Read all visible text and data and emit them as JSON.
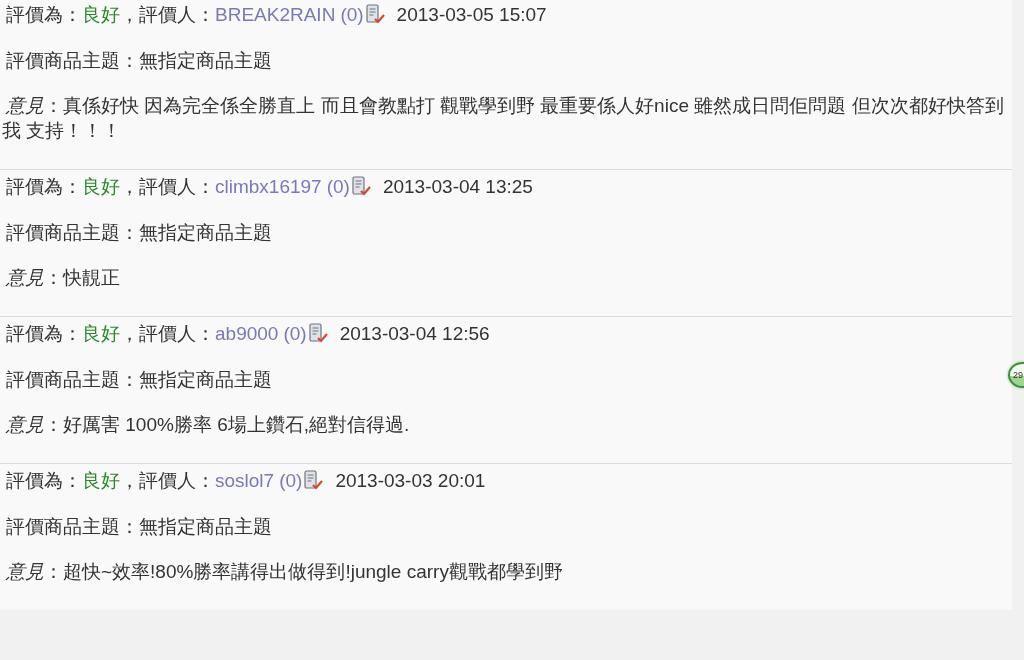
{
  "reviews": [
    {
      "rating_label": "評價為：",
      "rating": "良好",
      "reviewer_label": "，評價人：",
      "reviewer": "BREAK2RAIN",
      "score": "(0)",
      "date": "2013-03-05 15:07",
      "subject": "評價商品主題：無指定商品主題",
      "opinion": "*意見*：真係好快 因為完全係全勝直上 而且會教點打 觀戰學到野 最重要係人好nice 雖然成日問佢問題 但次次都好快答到我 支持！！！"
    },
    {
      "rating_label": "評價為：",
      "rating": "良好",
      "reviewer_label": "，評價人：",
      "reviewer": "climbx16197",
      "score": "(0)",
      "date": "2013-03-04 13:25",
      "subject": "評價商品主題：無指定商品主題",
      "opinion": "*意見*：快靚正"
    },
    {
      "rating_label": "評價為：",
      "rating": "良好",
      "reviewer_label": "，評價人：",
      "reviewer": "ab9000",
      "score": "(0)",
      "date": "2013-03-04 12:56",
      "subject": "評價商品主題：無指定商品主題",
      "opinion": "*意見*：好厲害 100%勝率 6場上鑽石,絕對信得過."
    },
    {
      "rating_label": "評價為：",
      "rating": "良好",
      "reviewer_label": "，評價人：",
      "reviewer": "soslol7",
      "score": "(0)",
      "date": "2013-03-03 20:01",
      "subject": "評價商品主題：無指定商品主題",
      "opinion": "*意見*：超快~效率!80%勝率講得出做得到!jungle carry觀戰都學到野"
    }
  ],
  "floating_badge": {
    "text": "29"
  }
}
